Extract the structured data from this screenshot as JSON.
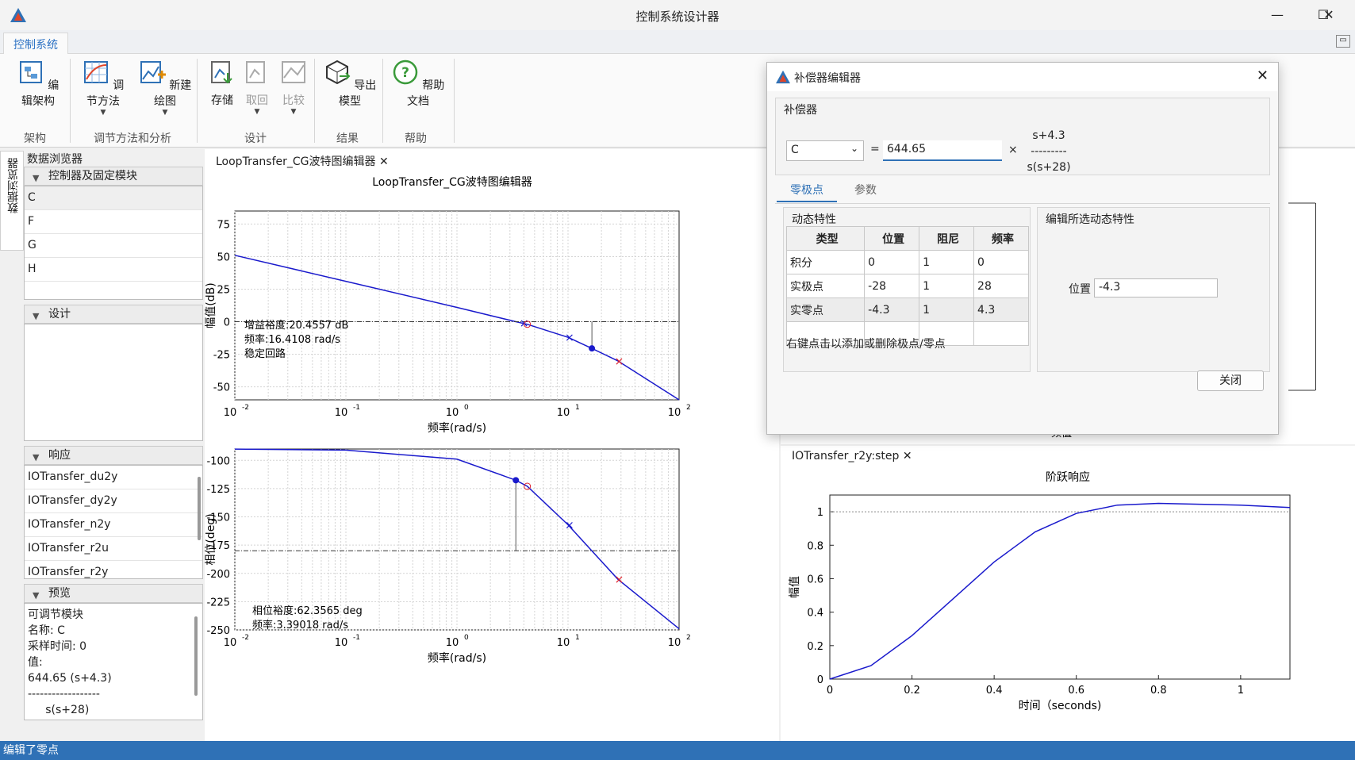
{
  "window": {
    "title": "控制系统设计器",
    "minimize": "—",
    "maximize": "☐",
    "close": "✕"
  },
  "ribbon": {
    "tab": "控制系统",
    "buttons": {
      "edit_arch": "编辑架构",
      "tune_method": "调节方法",
      "new_plot": "新建绘图",
      "store": "存储",
      "retrieve": "取回",
      "compare": "比较",
      "export": "导出模型",
      "help": "帮助文档"
    },
    "groups": {
      "arch": "架构",
      "tune": "调节方法和分析",
      "design": "设计",
      "result": "结果",
      "help": "帮助"
    }
  },
  "side_tab": "数据浏览器",
  "browser": {
    "title": "数据浏览器",
    "sections": {
      "blocks": "控制器及固定模块",
      "design": "设计",
      "response": "响应",
      "preview": "预览"
    },
    "blocks": [
      "C",
      "F",
      "G",
      "H"
    ],
    "responses": [
      "IOTransfer_du2y",
      "IOTransfer_dy2y",
      "IOTransfer_n2y",
      "IOTransfer_r2u",
      "IOTransfer_r2y"
    ],
    "preview_lines": [
      "可调节模块",
      "名称:  C",
      "采样时间:  0",
      "值:",
      "644.65 (s+4.3)",
      "------------------",
      "     s(s+28)"
    ]
  },
  "bode": {
    "tab": "LoopTransfer_CG波特图编辑器",
    "title": "LoopTransfer_CG波特图编辑器",
    "mag_ylabel": "幅值(dB)",
    "phase_ylabel": "相位(deg)",
    "xlabel": "频率(rad/s)",
    "mag_yticks": [
      "75",
      "50",
      "25",
      "0",
      "-25",
      "-50"
    ],
    "phase_yticks": [
      "-100",
      "-125",
      "-150",
      "-175",
      "-200",
      "-225",
      "-250"
    ],
    "x_ticks": [
      "-2",
      "-1",
      "0",
      "1",
      "2"
    ],
    "x_tick_base": "10",
    "gain_margin": "增益裕度:20.4557 dB",
    "gain_freq": "频率:16.4108 rad/s",
    "stable": "稳定回路",
    "phase_margin": "相位裕度:62.3565 deg",
    "phase_freq": "频率:3.39018 rad/s",
    "line_color": "#1a1acc",
    "pole_color": "#1a1acc",
    "zero_color": "#e0202a"
  },
  "step": {
    "tab": "IOTransfer_r2y:step",
    "title": "阶跃响应",
    "ylabel": "幅值",
    "xlabel": "时间（seconds)",
    "yticks": [
      "0",
      "0.2",
      "0.4",
      "0.6",
      "0.8",
      "1"
    ],
    "xticks": [
      "0",
      "0.2",
      "0.4",
      "0.6",
      "0.8",
      "1"
    ],
    "partial_label": "频值"
  },
  "dialog": {
    "title": "补偿器编辑器",
    "group": "补偿器",
    "compensator": "C",
    "eq": "=",
    "gain": "644.65",
    "times": "×",
    "num": "s+4.3",
    "bar": "---------",
    "den": "s(s+28)",
    "tabs": [
      "零极点",
      "参数"
    ],
    "dyn_label": "动态特性",
    "edit_label": "编辑所选动态特性",
    "table_headers": [
      "类型",
      "位置",
      "阻尼",
      "频率"
    ],
    "table_rows": [
      [
        "积分",
        "0",
        "1",
        "0"
      ],
      [
        "实极点",
        "-28",
        "1",
        "28"
      ],
      [
        "实零点",
        "-4.3",
        "1",
        "4.3"
      ]
    ],
    "hint": "右键点击以添加或删除极点/零点",
    "pos_label": "位置",
    "pos_value": "-4.3",
    "close_btn": "关闭"
  },
  "chart_data": [
    {
      "type": "line",
      "title": "LoopTransfer_CG波特图编辑器",
      "xlabel": "频率(rad/s)",
      "ylabel": "幅值(dB)",
      "xscale": "log",
      "xlim": [
        0.01,
        100
      ],
      "ylim": [
        -60,
        85
      ],
      "x": [
        0.01,
        0.1,
        1,
        3.39,
        4.3,
        10,
        16.41,
        28,
        100
      ],
      "series": [
        {
          "values": [
            51,
            31,
            11,
            0,
            -2,
            -12,
            -20.5,
            -30,
            -60
          ]
        }
      ]
    },
    {
      "type": "line",
      "xlabel": "频率(rad/s)",
      "ylabel": "相位(deg)",
      "xscale": "log",
      "xlim": [
        0.01,
        100
      ],
      "ylim": [
        -250,
        -90
      ],
      "x": [
        0.01,
        0.1,
        1,
        3.39,
        4.3,
        10,
        28,
        100
      ],
      "series": [
        {
          "values": [
            -90.1,
            -91,
            -99,
            -117.6,
            -123,
            -157,
            -205,
            -249
          ]
        }
      ]
    },
    {
      "type": "line",
      "title": "阶跃响应",
      "xlabel": "时间（seconds)",
      "ylabel": "幅值",
      "xlim": [
        0,
        1.12
      ],
      "ylim": [
        0,
        1.1
      ],
      "x": [
        0,
        0.1,
        0.2,
        0.3,
        0.4,
        0.5,
        0.6,
        0.7,
        0.8,
        0.9,
        1.0,
        1.12
      ],
      "series": [
        {
          "values": [
            0,
            0.08,
            0.26,
            0.48,
            0.7,
            0.88,
            0.99,
            1.04,
            1.05,
            1.045,
            1.04,
            1.025
          ]
        }
      ]
    }
  ]
}
